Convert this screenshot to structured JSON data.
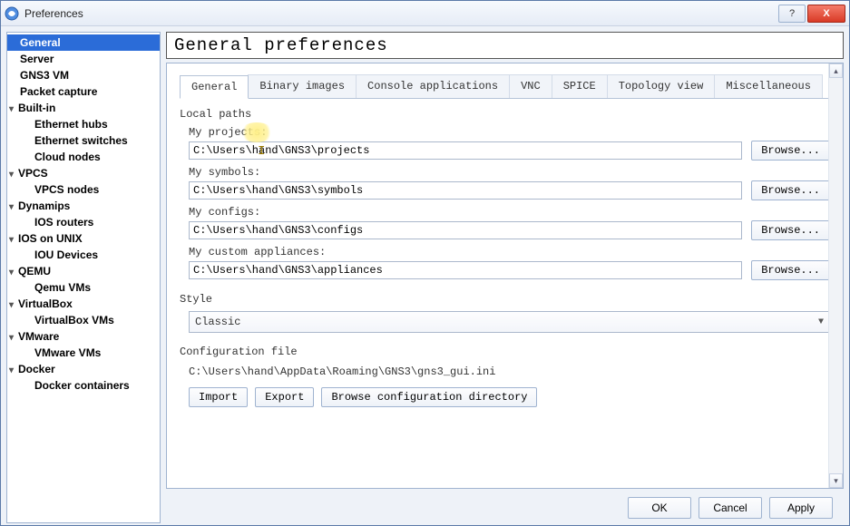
{
  "window": {
    "title": "Preferences"
  },
  "winbuttons": {
    "min": "—",
    "max": "❐",
    "close": "X"
  },
  "sidebar": [
    {
      "label": "General",
      "level": 0,
      "sel": true,
      "exp": null
    },
    {
      "label": "Server",
      "level": 0
    },
    {
      "label": "GNS3 VM",
      "level": 0
    },
    {
      "label": "Packet capture",
      "level": 0
    },
    {
      "label": "Built-in",
      "level": 0,
      "exp": true
    },
    {
      "label": "Ethernet hubs",
      "level": 1
    },
    {
      "label": "Ethernet switches",
      "level": 1
    },
    {
      "label": "Cloud nodes",
      "level": 1
    },
    {
      "label": "VPCS",
      "level": 0,
      "exp": true
    },
    {
      "label": "VPCS nodes",
      "level": 1
    },
    {
      "label": "Dynamips",
      "level": 0,
      "exp": true
    },
    {
      "label": "IOS routers",
      "level": 1
    },
    {
      "label": "IOS on UNIX",
      "level": 0,
      "exp": true
    },
    {
      "label": "IOU Devices",
      "level": 1
    },
    {
      "label": "QEMU",
      "level": 0,
      "exp": true
    },
    {
      "label": "Qemu VMs",
      "level": 1
    },
    {
      "label": "VirtualBox",
      "level": 0,
      "exp": true
    },
    {
      "label": "VirtualBox VMs",
      "level": 1
    },
    {
      "label": "VMware",
      "level": 0,
      "exp": true
    },
    {
      "label": "VMware VMs",
      "level": 1
    },
    {
      "label": "Docker",
      "level": 0,
      "exp": true
    },
    {
      "label": "Docker containers",
      "level": 1
    }
  ],
  "heading": "General preferences",
  "tabs": [
    "General",
    "Binary images",
    "Console applications",
    "VNC",
    "SPICE",
    "Topology view",
    "Miscellaneous"
  ],
  "activeTab": 0,
  "sections": {
    "localpaths": {
      "title": "Local paths",
      "projects": {
        "label": "My projects:",
        "value": "C:\\Users\\hand\\GNS3\\projects",
        "browse": "Browse..."
      },
      "symbols": {
        "label": "My symbols:",
        "value": "C:\\Users\\hand\\GNS3\\symbols",
        "browse": "Browse..."
      },
      "configs": {
        "label": "My configs:",
        "value": "C:\\Users\\hand\\GNS3\\configs",
        "browse": "Browse..."
      },
      "appliances": {
        "label": "My custom appliances:",
        "value": "C:\\Users\\hand\\GNS3\\appliances",
        "browse": "Browse..."
      }
    },
    "style": {
      "title": "Style",
      "value": "Classic"
    },
    "config": {
      "title": "Configuration file",
      "path": "C:\\Users\\hand\\AppData\\Roaming\\GNS3\\gns3_gui.ini",
      "import": "Import",
      "export": "Export",
      "browsecfg": "Browse configuration directory"
    }
  },
  "footer": {
    "ok": "OK",
    "cancel": "Cancel",
    "apply": "Apply"
  }
}
